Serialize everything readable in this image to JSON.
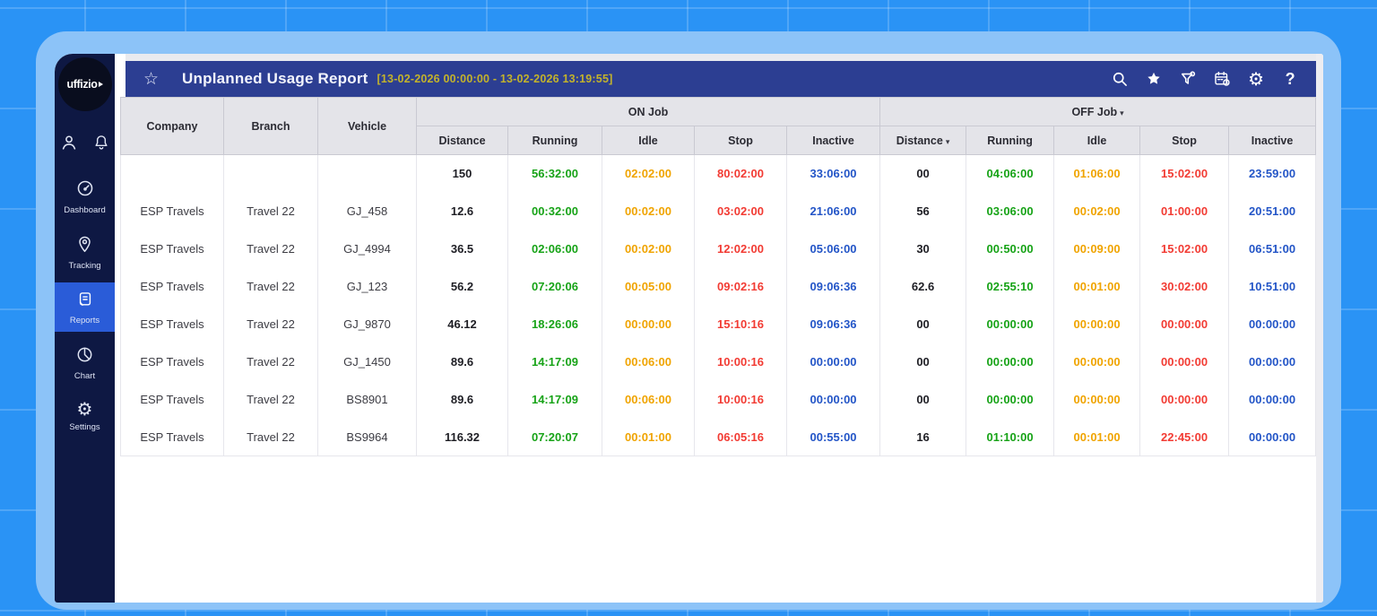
{
  "header": {
    "title": "Unplanned Usage Report",
    "date_range": "[13-02-2026 00:00:00 - 13-02-2026 13:19:55]",
    "icons": [
      "favorite-star-outline-icon",
      "search-icon",
      "favorite-star-filled-icon",
      "filter-funnel-icon",
      "calendar-clock-icon",
      "settings-gear-icon",
      "help-icon"
    ],
    "glyphs": {
      "star_outline": "☆",
      "gear": "⚙",
      "help": "?"
    }
  },
  "sidebar": {
    "logo_text": "uffizio",
    "top_icons": [
      "user-icon",
      "bell-icon"
    ],
    "items": [
      {
        "label": "Dashboard",
        "icon": "dashboard-speedometer-icon",
        "active": false
      },
      {
        "label": "Tracking",
        "icon": "tracking-pin-icon",
        "active": false
      },
      {
        "label": "Reports",
        "icon": "reports-document-icon",
        "active": true
      },
      {
        "label": "Chart",
        "icon": "chart-pie-icon",
        "active": false
      },
      {
        "label": "Settings",
        "icon": "settings-gear-icon",
        "active": false
      }
    ]
  },
  "table": {
    "fixed_columns": [
      "Company",
      "Branch",
      "Vehicle"
    ],
    "on_job_label": "ON Job",
    "off_job_label": "OFF Job",
    "sort_arrow": "▾",
    "on_sub": [
      "Distance",
      "Running",
      "Idle",
      "Stop",
      "Inactive"
    ],
    "off_sub": [
      "Distance",
      "Running",
      "Idle",
      "Stop",
      "Inactive"
    ],
    "rows": [
      {
        "company": "",
        "branch": "",
        "vehicle": "",
        "on_distance": "150",
        "on_running": "56:32:00",
        "on_idle": "02:02:00",
        "on_stop": "80:02:00",
        "on_inactive": "33:06:00",
        "off_distance": "00",
        "off_running": "04:06:00",
        "off_idle": "01:06:00",
        "off_stop": "15:02:00",
        "off_inactive": "23:59:00"
      },
      {
        "company": "ESP Travels",
        "branch": "Travel 22",
        "vehicle": "GJ_458",
        "on_distance": "12.6",
        "on_running": "00:32:00",
        "on_idle": "00:02:00",
        "on_stop": "03:02:00",
        "on_inactive": "21:06:00",
        "off_distance": "56",
        "off_running": "03:06:00",
        "off_idle": "00:02:00",
        "off_stop": "01:00:00",
        "off_inactive": "20:51:00"
      },
      {
        "company": "ESP Travels",
        "branch": "Travel 22",
        "vehicle": "GJ_4994",
        "on_distance": "36.5",
        "on_running": "02:06:00",
        "on_idle": "00:02:00",
        "on_stop": "12:02:00",
        "on_inactive": "05:06:00",
        "off_distance": "30",
        "off_running": "00:50:00",
        "off_idle": "00:09:00",
        "off_stop": "15:02:00",
        "off_inactive": "06:51:00"
      },
      {
        "company": "ESP Travels",
        "branch": "Travel 22",
        "vehicle": "GJ_123",
        "on_distance": "56.2",
        "on_running": "07:20:06",
        "on_idle": "00:05:00",
        "on_stop": "09:02:16",
        "on_inactive": "09:06:36",
        "off_distance": "62.6",
        "off_running": "02:55:10",
        "off_idle": "00:01:00",
        "off_stop": "30:02:00",
        "off_inactive": "10:51:00"
      },
      {
        "company": "ESP Travels",
        "branch": "Travel 22",
        "vehicle": "GJ_9870",
        "on_distance": "46.12",
        "on_running": "18:26:06",
        "on_idle": "00:00:00",
        "on_stop": "15:10:16",
        "on_inactive": "09:06:36",
        "off_distance": "00",
        "off_running": "00:00:00",
        "off_idle": "00:00:00",
        "off_stop": "00:00:00",
        "off_inactive": "00:00:00"
      },
      {
        "company": "ESP Travels",
        "branch": "Travel 22",
        "vehicle": "GJ_1450",
        "on_distance": "89.6",
        "on_running": "14:17:09",
        "on_idle": "00:06:00",
        "on_stop": "10:00:16",
        "on_inactive": "00:00:00",
        "off_distance": "00",
        "off_running": "00:00:00",
        "off_idle": "00:00:00",
        "off_stop": "00:00:00",
        "off_inactive": "00:00:00"
      },
      {
        "company": "ESP Travels",
        "branch": "Travel 22",
        "vehicle": "BS8901",
        "on_distance": "89.6",
        "on_running": "14:17:09",
        "on_idle": "00:06:00",
        "on_stop": "10:00:16",
        "on_inactive": "00:00:00",
        "off_distance": "00",
        "off_running": "00:00:00",
        "off_idle": "00:00:00",
        "off_stop": "00:00:00",
        "off_inactive": "00:00:00"
      },
      {
        "company": "ESP Travels",
        "branch": "Travel 22",
        "vehicle": "BS9964",
        "on_distance": "116.32",
        "on_running": "07:20:07",
        "on_idle": "00:01:00",
        "on_stop": "06:05:16",
        "on_inactive": "00:55:00",
        "off_distance": "16",
        "off_running": "01:10:00",
        "off_idle": "00:01:00",
        "off_stop": "22:45:00",
        "off_inactive": "00:00:00"
      }
    ]
  },
  "colors": {
    "backdrop": "#2a93f5",
    "frame": "#8cc3f8",
    "sidebar": "#0e1843",
    "active_nav": "#2a5cd8",
    "appbar": "#2c3e92",
    "date_text": "#c3b32b",
    "running": "#17a317",
    "idle": "#f0a400",
    "stop": "#f23b33",
    "inactive": "#2355c7",
    "header_cell": "#e4e4e9"
  }
}
